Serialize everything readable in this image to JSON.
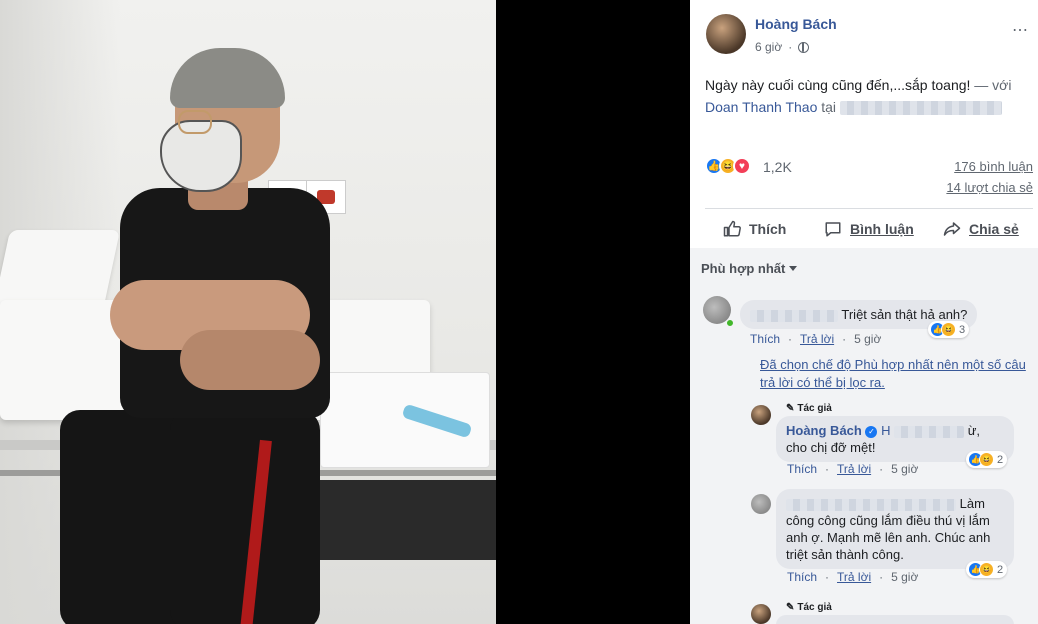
{
  "post": {
    "author": "Hoàng Bách",
    "time": "6 giờ",
    "text_main": "Ngày này cuối cùng cũng đến,...sắp toang!",
    "text_with": " — với",
    "tagged_user": "Doan Thanh Thao",
    "text_at": "tại",
    "more_icon": "⋯",
    "reaction_count": "1,2K",
    "comments_count": "176 bình luận",
    "shares_count": "14 lượt chia sẻ",
    "like_label": "Thích",
    "comment_label": "Bình luận",
    "share_label": "Chia sẻ",
    "colors": {
      "link": "#385898",
      "like": "#1877f2",
      "love": "#f33e58",
      "haha": "#f7b125"
    }
  },
  "comments": {
    "sort_label": "Phù hợp nhất",
    "filter_notice": "Đã chọn chế độ Phù hợp nhất nên một số câu trả lời có thể bị lọc ra.",
    "author_tag": "Tác giả",
    "items": [
      {
        "text": "Triệt sản thật hả anh?",
        "like": "Thích",
        "reply": "Trả lời",
        "time": "5 giờ",
        "reactions": "3"
      },
      {
        "author": "Hoàng Bách",
        "text_prefix": "H",
        "text_mid": "ừ,",
        "text_end": "cho chị đỡ mệt!",
        "like": "Thích",
        "reply": "Trả lời",
        "time": "5 giờ",
        "reactions": "2"
      },
      {
        "text_a": "Làm",
        "text_b": "công công cũng lắm điều thú vị lắm anh ợ. Mạnh mẽ lên anh. Chúc anh triệt sản thành công.",
        "like": "Thích",
        "reply": "Trả lời",
        "time": "5 giờ",
        "reactions": "2"
      }
    ],
    "last_author_tag": "Tác giả"
  }
}
